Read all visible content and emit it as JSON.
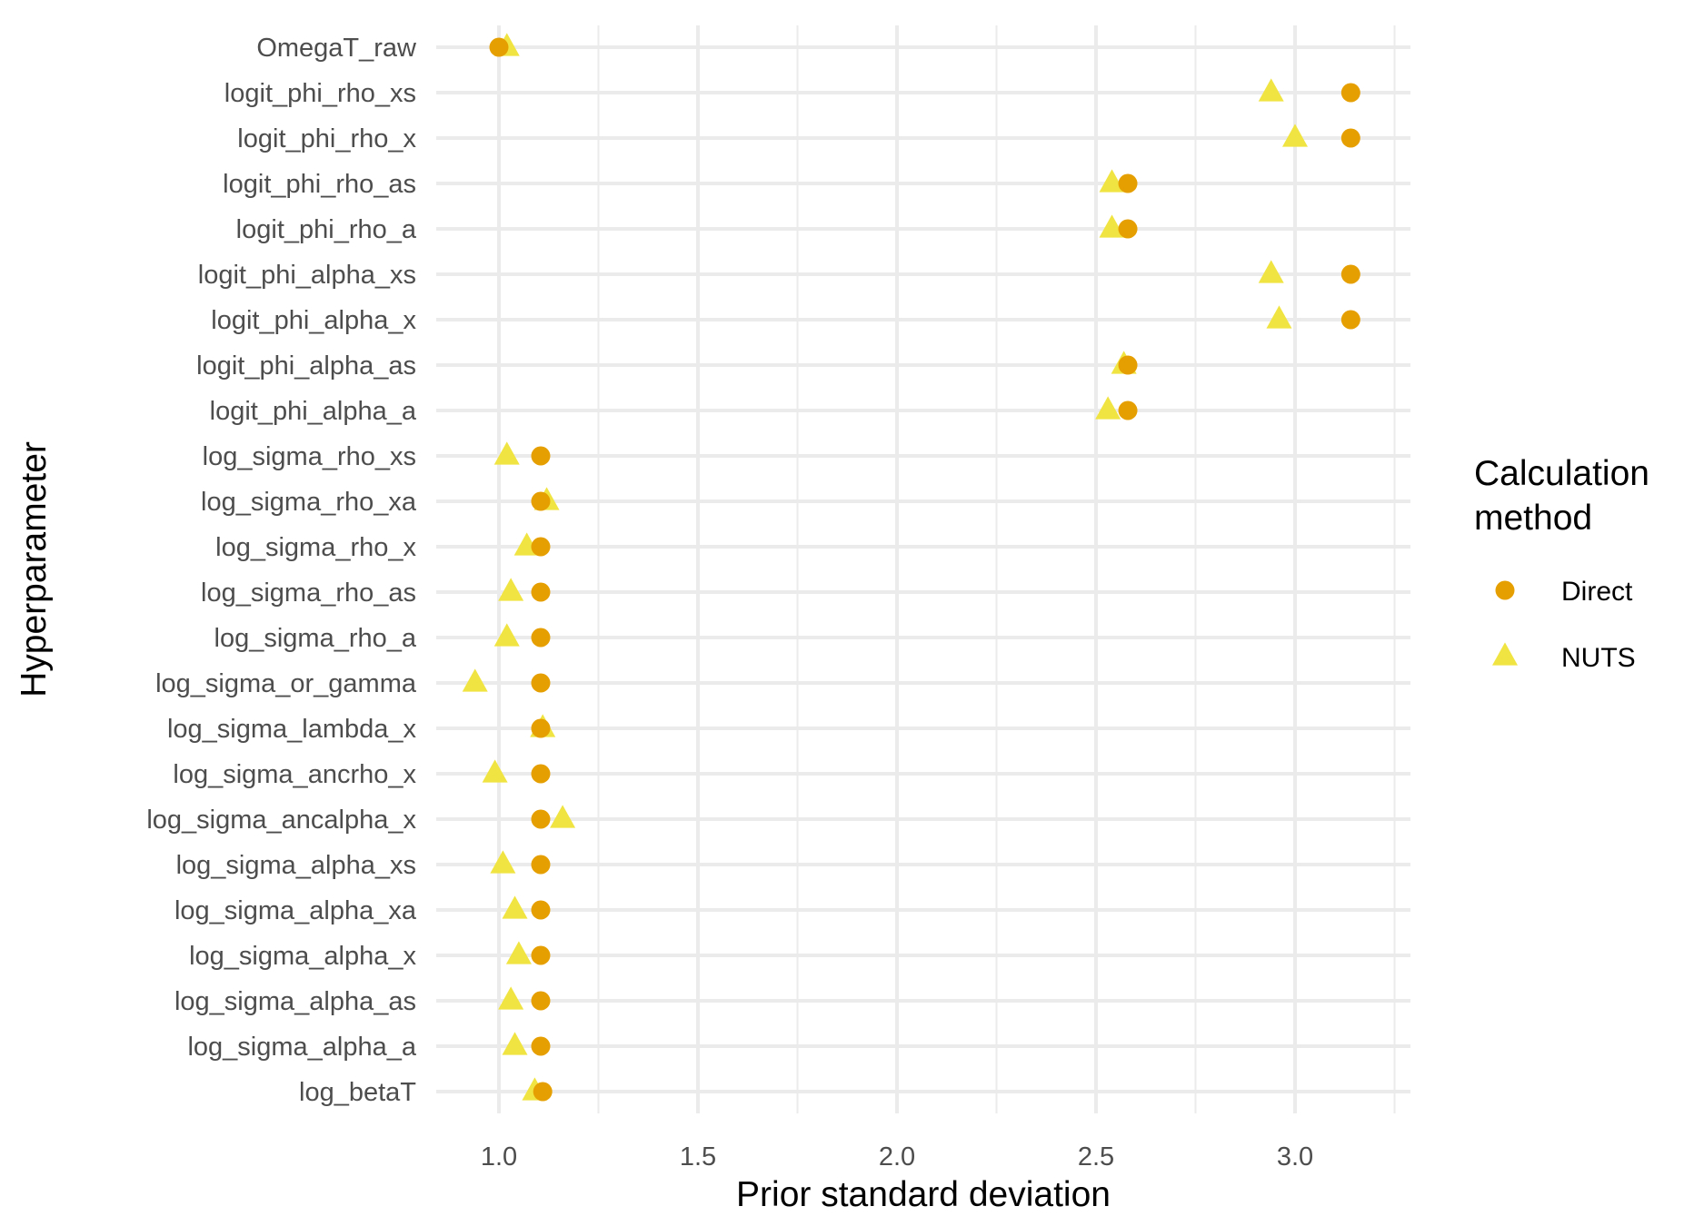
{
  "chart_data": {
    "type": "scatter",
    "title": "",
    "xlabel": "Prior standard deviation",
    "ylabel": "Hyperparameter",
    "xlim": [
      0.83,
      3.27
    ],
    "xticks": [
      1.0,
      1.5,
      2.0,
      2.5,
      3.0
    ],
    "xtick_labels": [
      "1.0",
      "1.5",
      "2.0",
      "2.5",
      "3.0"
    ],
    "grid": true,
    "legend": {
      "title": "Calculation\nmethod",
      "title_lines": [
        "Calculation",
        "method"
      ],
      "placement": "right",
      "entries": [
        {
          "label": "Direct",
          "shape": "circle",
          "color": "#E69F00"
        },
        {
          "label": "NUTS",
          "shape": "triangle",
          "color": "#F0E442"
        }
      ]
    },
    "categories": [
      "OmegaT_raw",
      "logit_phi_rho_xs",
      "logit_phi_rho_x",
      "logit_phi_rho_as",
      "logit_phi_rho_a",
      "logit_phi_alpha_xs",
      "logit_phi_alpha_x",
      "logit_phi_alpha_as",
      "logit_phi_alpha_a",
      "log_sigma_rho_xs",
      "log_sigma_rho_xa",
      "log_sigma_rho_x",
      "log_sigma_rho_as",
      "log_sigma_rho_a",
      "log_sigma_or_gamma",
      "log_sigma_lambda_x",
      "log_sigma_ancrho_x",
      "log_sigma_ancalpha_x",
      "log_sigma_alpha_xs",
      "log_sigma_alpha_xa",
      "log_sigma_alpha_x",
      "log_sigma_alpha_as",
      "log_sigma_alpha_a",
      "log_betaT"
    ],
    "series": [
      {
        "name": "Direct",
        "shape": "circle",
        "color": "#E69F00",
        "values": [
          1.0,
          3.14,
          3.14,
          2.58,
          2.58,
          3.14,
          3.14,
          2.58,
          2.58,
          1.105,
          1.105,
          1.105,
          1.105,
          1.105,
          1.105,
          1.105,
          1.105,
          1.105,
          1.105,
          1.105,
          1.105,
          1.105,
          1.105,
          1.11
        ]
      },
      {
        "name": "NUTS",
        "shape": "triangle",
        "color": "#F0E442",
        "values": [
          1.02,
          2.94,
          3.0,
          2.54,
          2.54,
          2.94,
          2.96,
          2.57,
          2.53,
          1.02,
          1.12,
          1.07,
          1.03,
          1.02,
          0.94,
          1.11,
          0.99,
          1.16,
          1.01,
          1.04,
          1.05,
          1.03,
          1.04,
          1.09
        ]
      }
    ]
  }
}
